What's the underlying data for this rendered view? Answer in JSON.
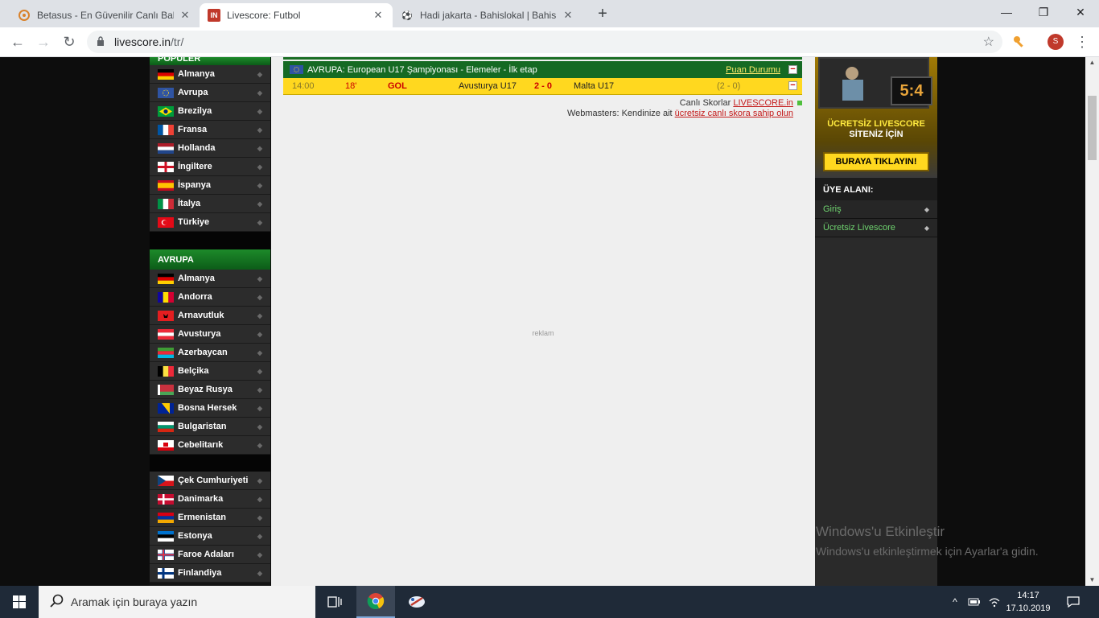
{
  "browser": {
    "tabs": [
      {
        "title": "Betasus - En Güvenilir Canlı Bahis",
        "icon": "betasus-favicon"
      },
      {
        "title": "Livescore: Futbol",
        "icon": "livescore-favicon",
        "favicon_text": "IN"
      },
      {
        "title": "Hadi jakarta - Bahislokal | Bahis f",
        "icon": "soccer-ball-favicon",
        "favicon_text": "⚽"
      }
    ],
    "new_tab": "+",
    "url": {
      "host": "livescore.in",
      "path": "/tr/"
    },
    "profile_initial": "S",
    "window": {
      "minimize": "—",
      "maximize": "❐",
      "close": "✕"
    },
    "nav": {
      "back": "←",
      "forward": "→",
      "reload": "↻",
      "star": "☆",
      "menu": "⋮"
    }
  },
  "left_nav": {
    "popular_title": "POPÜLER",
    "popular": [
      {
        "label": "Almanya",
        "flag": "de"
      },
      {
        "label": "Avrupa",
        "flag": "eu"
      },
      {
        "label": "Brezilya",
        "flag": "br"
      },
      {
        "label": "Fransa",
        "flag": "fr"
      },
      {
        "label": "Hollanda",
        "flag": "nl"
      },
      {
        "label": "İngiltere",
        "flag": "en"
      },
      {
        "label": "İspanya",
        "flag": "es"
      },
      {
        "label": "İtalya",
        "flag": "it"
      },
      {
        "label": "Türkiye",
        "flag": "tr"
      }
    ],
    "europe_title": "AVRUPA",
    "europe": [
      {
        "label": "Almanya",
        "flag": "de"
      },
      {
        "label": "Andorra",
        "flag": "ad"
      },
      {
        "label": "Arnavutluk",
        "flag": "al"
      },
      {
        "label": "Avusturya",
        "flag": "at"
      },
      {
        "label": "Azerbaycan",
        "flag": "az"
      },
      {
        "label": "Belçika",
        "flag": "be"
      },
      {
        "label": "Beyaz Rusya",
        "flag": "by"
      },
      {
        "label": "Bosna Hersek",
        "flag": "ba"
      },
      {
        "label": "Bulgaristan",
        "flag": "bg"
      },
      {
        "label": "Cebelitarık",
        "flag": "gi"
      }
    ],
    "europe_more": [
      {
        "label": "Çek Cumhuriyeti",
        "flag": "cz"
      },
      {
        "label": "Danimarka",
        "flag": "dk"
      },
      {
        "label": "Ermenistan",
        "flag": "am"
      },
      {
        "label": "Estonya",
        "flag": "ee"
      },
      {
        "label": "Faroe Adaları",
        "flag": "fo"
      },
      {
        "label": "Finlandiya",
        "flag": "fi"
      }
    ]
  },
  "main": {
    "league": {
      "title": "AVRUPA: European U17 Şampiyonası - Elemeler - İlk etap",
      "standings_link": "Puan Durumu"
    },
    "match": {
      "time": "14:00",
      "minute": "18'",
      "event": "GOL",
      "home": "Avusturya U17",
      "score": "2 - 0",
      "away": "Malta U17",
      "halftime": "(2 - 0)"
    },
    "footer_line1": "Canlı Skorlar",
    "footer_link1": "LIVESCORE.in",
    "footer_line2": "Webmasters: Kendinize ait",
    "footer_link2": "ücretsiz canlı skora sahip olun",
    "ad_label": "reklam"
  },
  "right_col": {
    "promo_score": "5:4",
    "promo_line1": "ÜCRETSİZ LIVESCORE",
    "promo_line2": "SİTENİZ İÇİN",
    "promo_button": "BURAYA TIKLAYIN!",
    "member_title": "ÜYE ALANI:",
    "member_items": [
      "Giriş",
      "Ücretsiz Livescore"
    ]
  },
  "watermark": {
    "title": "Windows'u Etkinleştir",
    "subtitle": "Windows'u etkinleştirmek için Ayarlar'a gidin."
  },
  "taskbar": {
    "search_placeholder": "Aramak için buraya yazın",
    "time": "14:17",
    "date": "17.10.2019"
  }
}
